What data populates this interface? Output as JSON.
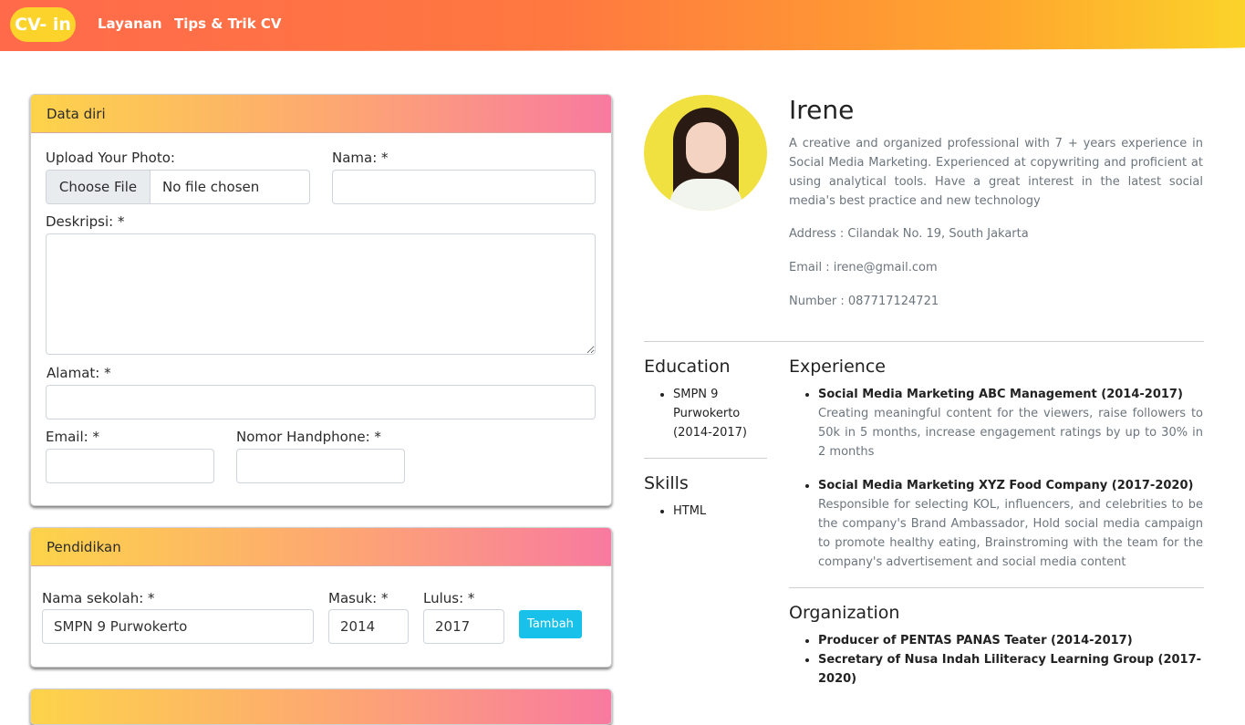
{
  "header": {
    "brand": "CV- in",
    "nav": [
      "Layanan",
      "Tips & Trik CV"
    ]
  },
  "form_data_diri": {
    "title": "Data diri",
    "photo_label": "Upload Your Photo:",
    "file_button": "Choose File",
    "file_status": "No file chosen",
    "nama_label": "Nama: *",
    "nama_value": "",
    "deskripsi_label": "Deskripsi: *",
    "deskripsi_value": "",
    "alamat_label": "Alamat: *",
    "alamat_value": "",
    "email_label": "Email: *",
    "email_value": "",
    "hp_label": "Nomor Handphone: *",
    "hp_value": ""
  },
  "form_pendidikan": {
    "title": "Pendidikan",
    "sekolah_label": "Nama sekolah: *",
    "sekolah_value": "SMPN 9 Purwokerto",
    "masuk_label": "Masuk: *",
    "masuk_value": "2014",
    "lulus_label": "Lulus: *",
    "lulus_value": "2017",
    "add_button": "Tambah"
  },
  "cv": {
    "name": "Irene",
    "description": "A creative and organized professional with 7 + years experience in Social Media Marketing. Experienced at copywriting and proficient at using analytical tools. Have a great interest in the latest social media's best practice and new technology",
    "address": "Address : Cilandak No. 19, South Jakarta",
    "email": "Email : irene@gmail.com",
    "number": "Number : 087717124721",
    "education_title": "Education",
    "education": [
      "SMPN 9 Purwokerto (2014-2017)"
    ],
    "skills_title": "Skills",
    "skills": [
      "HTML"
    ],
    "experience_title": "Experience",
    "experience": [
      {
        "title": "Social Media Marketing ABC Management (2014-2017)",
        "desc": "Creating meaningful content for the viewers, raise followers to 50k in 5 months, increase engagement ratings by up to 30% in 2 months"
      },
      {
        "title": "Social Media Marketing XYZ Food Company (2017-2020)",
        "desc": "Responsible for selecting KOL, influencers, and celebrities to be the company's Brand Ambassador, Hold social media campaign to promote healthy eating, Brainstroming with the team for the company's advertisement and social media content"
      }
    ],
    "organization_title": "Organization",
    "organization": [
      "Producer of PENTAS PANAS Teater (2014-2017)",
      "Secretary of Nusa Indah Liliteracy Learning Group (2017-2020)"
    ]
  }
}
